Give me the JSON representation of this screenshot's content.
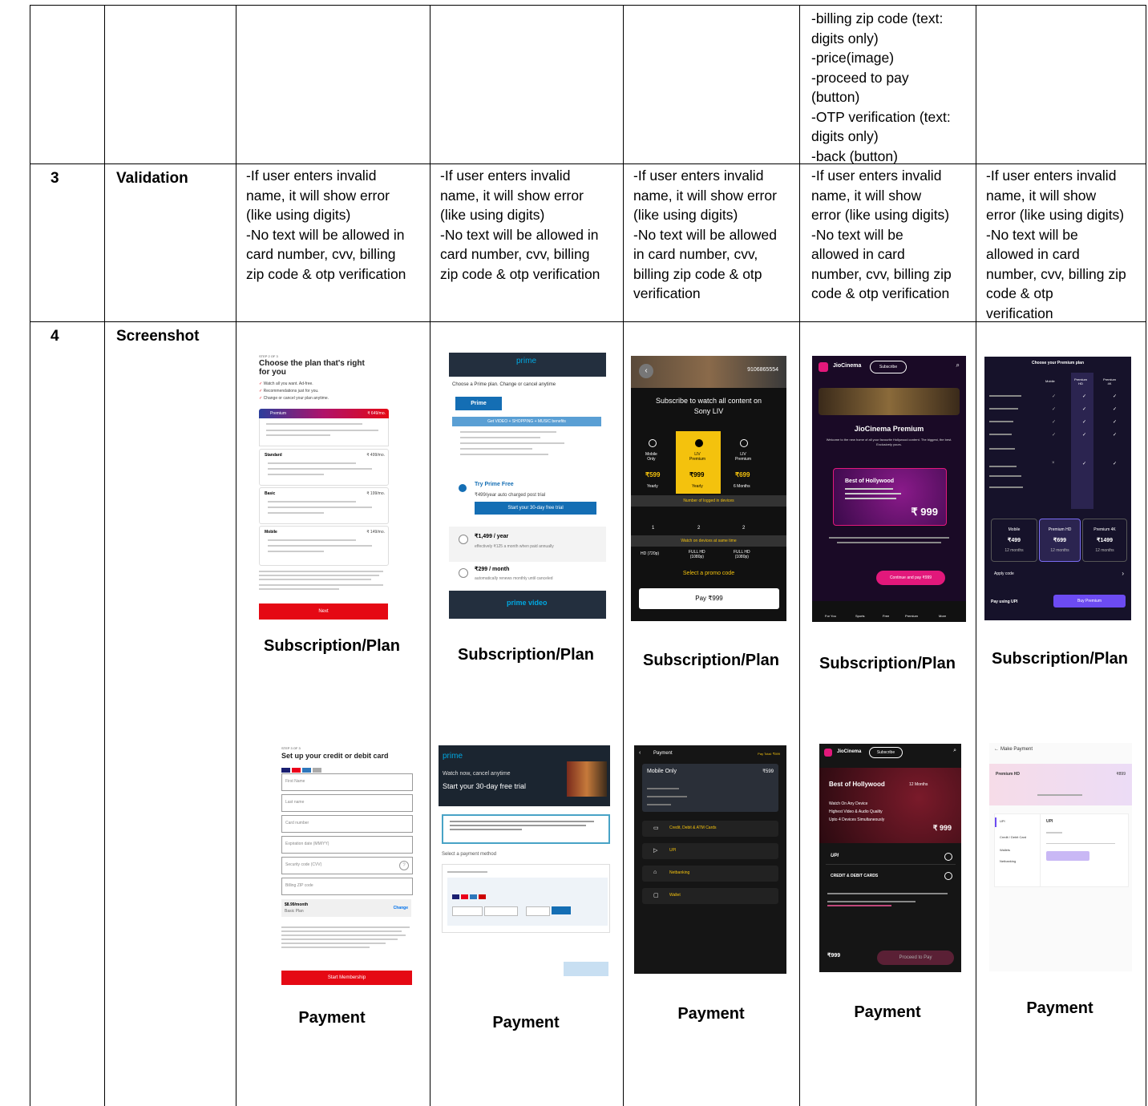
{
  "top_row": {
    "col6_text": "-billing zip code (text:\ndigits only)\n-price(image)\n-proceed to pay\n(button)\n-OTP verification (text:\ndigits only)\n-back (button)"
  },
  "row3": {
    "number": "3",
    "title": "Validation",
    "cells": [
      "-If user enters invalid\nname, it will show error\n(like using digits)\n-No text will be allowed in\ncard number, cvv, billing\nzip code & otp verification",
      "-If user enters invalid\nname, it will show error\n(like using digits)\n-No text will be allowed in\ncard number, cvv, billing\nzip code & otp verification",
      "-If user enters invalid\nname, it will show error\n(like using digits)\n-No text will be allowed\nin card number, cvv,\nbilling zip code & otp\nverification",
      "-If user enters invalid\nname, it will show\nerror (like using digits)\n-No text will be\nallowed in card\nnumber, cvv, billing zip\ncode & otp verification",
      "-If user enters invalid\nname, it will show\nerror (like using digits)\n-No text will be\nallowed in card\nnumber, cvv, billing zip\ncode & otp\nverification"
    ]
  },
  "row4": {
    "number": "4",
    "title": "Screenshot",
    "plan_caption": "Subscription/Plan",
    "payment_caption": "Payment"
  },
  "netflix_plan": {
    "step": "STEP 2 OF 3",
    "heading": "Choose the plan that's right\nfor you",
    "checks": [
      "Watch all you want. Ad-free.",
      "Recommendations just for you.",
      "Change or cancel your plan anytime."
    ],
    "plans": [
      {
        "name": "Premium",
        "price": "₹ 649/mo."
      },
      {
        "name": "Standard",
        "price": "₹ 499/mo."
      },
      {
        "name": "Basic",
        "price": "₹ 199/mo."
      },
      {
        "name": "Mobile",
        "price": "₹ 149/mo."
      }
    ],
    "button": "Next"
  },
  "netflix_payment": {
    "step": "STEP 3 OF 3",
    "heading": "Set up your credit or debit card",
    "fields": [
      "First Name",
      "Last name",
      "Card number",
      "Expiration date (MM/YY)",
      "Security code (CVV)",
      "Billing ZIP code"
    ],
    "price": "$8.99/month",
    "plan": "Basic Plan",
    "change": "Change",
    "button": "Start Membership"
  },
  "prime_plan": {
    "logo": "prime",
    "choose": "Choose a Prime plan. Change or cancel anytime",
    "tab": "Prime",
    "benefits": "Get VIDEO + SHOPPING + MUSIC benefits",
    "try_title": "Try Prime Free",
    "try_sub": "₹499/year auto charged post trial",
    "trial_button": "Start your 30-day free trial",
    "year": "₹1,499 / year",
    "year_sub": "effectively ₹125 a month when paid annually",
    "month": "₹299 / month",
    "month_sub": "automatically renews monthly until canceled",
    "footer_logo": "prime video"
  },
  "prime_payment": {
    "logo": "prime",
    "line1": "Watch now, cancel anytime",
    "line2": "Start your 30-day free trial",
    "select": "Select a payment method"
  },
  "sony_plan": {
    "phone": "9106865554",
    "title": "Subscribe to watch all content on\nSony LIV",
    "plans": [
      {
        "name": "Mobile\nOnly",
        "price": "₹599",
        "period": "Yearly"
      },
      {
        "name": "LIV\nPremium",
        "price": "₹999",
        "period": "Yearly"
      },
      {
        "name": "LIV\nPremium",
        "price": "₹699",
        "period": "6 Months"
      }
    ],
    "devices_label": "Number of logged in devices",
    "devices": [
      "1",
      "2",
      "2"
    ],
    "same_time": "Watch on devices at same time",
    "quality": [
      "HD (720p)",
      "FULL HD\n(1080p)",
      "FULL HD\n(1080p)"
    ],
    "promo": "Select a promo code",
    "pay": "Pay ₹999"
  },
  "sony_payment": {
    "title": "Payment",
    "total": "Pay Total: ₹599",
    "plan": "Mobile Only",
    "plan_price": "₹599",
    "methods": [
      "Credit, Debit & ATM Cards",
      "UPI",
      "Netbanking",
      "Wallet"
    ]
  },
  "jio_plan": {
    "brand": "JioCinema",
    "subscribe": "Subscribe",
    "title": "JioCinema Premium",
    "tagline": "Welcome to the new home of all your favourite Hollywood content. The biggest, the best. Exclusively yours.",
    "card_title": "Best of Hollywood",
    "price": "₹ 999",
    "cta": "Continue and pay ₹999",
    "nav": [
      "For You",
      "Sports",
      "Free",
      "Premium",
      "More"
    ]
  },
  "jio_payment": {
    "brand": "JioCinema",
    "subscribe": "Subscribe",
    "title": "Best of Hollywood",
    "duration": "12 Months",
    "features": [
      "Watch On Any Device",
      "Highest Video & Audio Quality",
      "Upto 4 Devices Simultaneously"
    ],
    "price": "₹ 999",
    "methods": [
      "UPI",
      "CREDIT & DEBIT CARDS"
    ],
    "total": "₹999",
    "button": "Proceed to Pay"
  },
  "hotstar_plan": {
    "title": "Choose your Premium plan",
    "cols": [
      "Mobile",
      "Premium\nHD",
      "Premium\n4K"
    ],
    "plans": [
      {
        "name": "Mobile",
        "price": "₹499",
        "period": "12 months"
      },
      {
        "name": "Premium HD",
        "price": "₹699",
        "period": "12 months"
      },
      {
        "name": "Premium 4K",
        "price": "₹1499",
        "period": "12 months"
      }
    ],
    "apply": "Apply code",
    "pay_using": "Pay using UPI",
    "buy": "Buy Premium"
  },
  "hotstar_payment": {
    "title": "Make Payment",
    "plan": "Premium HD",
    "price": "₹899",
    "tabs": [
      "UPI",
      "Credit / Debit Card",
      "Wallets",
      "Netbanking"
    ],
    "upi": "UPI"
  },
  "colors": {
    "netflix_red": "#e50914",
    "prime_blue": "#146eb4",
    "sony_yellow": "#f4c20d",
    "jio_pink": "#e2187b",
    "hotstar_purple": "#6c4bf2"
  }
}
